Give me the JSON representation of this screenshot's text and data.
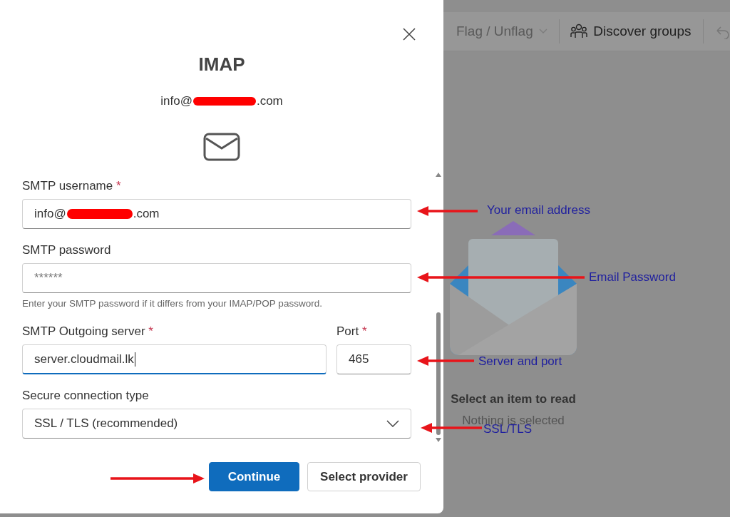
{
  "toolbar": {
    "items": [
      {
        "kind": "dropdown",
        "label": "Flag / Unflag",
        "disabled": true
      },
      {
        "kind": "button",
        "label": "Discover groups",
        "disabled": false
      }
    ]
  },
  "dialog": {
    "title": "IMAP",
    "account": {
      "prefix": "info@",
      "redacted": true,
      "suffix": ".com"
    },
    "fields": [
      {
        "kind": "text",
        "label": "SMTP username",
        "required_mark": "*",
        "value": {
          "prefix": "info@",
          "redacted": true,
          "suffix": ".com"
        }
      },
      {
        "kind": "password",
        "label": "SMTP password",
        "placeholder": "******",
        "hint": "Enter your SMTP password if it differs from your IMAP/POP password."
      },
      {
        "kind": "server",
        "label": "SMTP Outgoing server",
        "required_mark": "*",
        "value": "server.cloudmail.lk",
        "focused": true,
        "port": {
          "label": "Port",
          "required_mark": "*",
          "value": "465"
        }
      },
      {
        "kind": "select",
        "label": "Secure connection type",
        "value": "SSL / TLS (recommended)"
      }
    ],
    "buttons": [
      {
        "label": "Continue",
        "primary": true
      },
      {
        "label": "Select provider",
        "primary": false
      }
    ]
  },
  "reading_pane": {
    "title": "Select an item to read",
    "subtitle": "Nothing is selected"
  },
  "annotations": [
    {
      "text": "Your email address"
    },
    {
      "text": "Email Password"
    },
    {
      "text": "Server and port"
    },
    {
      "text": "SSL/TLS"
    }
  ]
}
